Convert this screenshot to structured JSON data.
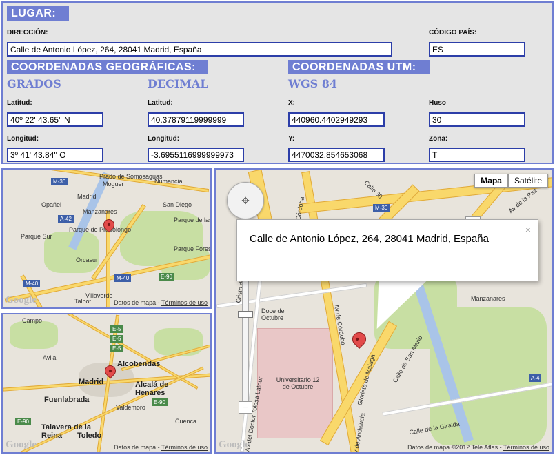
{
  "form": {
    "lugar_tag": "LUGAR:",
    "direccion_label": "DIRECCIÓN:",
    "direccion_value": "Calle de Antonio Lópe​z, 264, 28041 Madrid, España",
    "codigo_pais_label": "CÓDIGO PAÍS:",
    "codigo_pais_value": "ES",
    "geo_tag": "COORDENADAS GEOGRÁFICAS:",
    "utm_tag": "COORDENADAS UTM:",
    "grados_title": "GRADOS",
    "decimal_title": "DECIMAL",
    "wgs_title": "WGS 84",
    "latitud_label": "Latitud:",
    "longitud_label": "Longitud:",
    "x_label": "X:",
    "y_label": "Y:",
    "huso_label": "Huso",
    "zona_label": "Zona:",
    "lat_dms": "40º 22' 43.65'' N",
    "lon_dms": "3º 41' 43.84'' O",
    "lat_dec": "40.37879119999999",
    "lon_dec": "-3.6955116999999973",
    "utm_x": "440960.4402949293",
    "utm_y": "4470032.854653068",
    "huso": "30",
    "zona": "T"
  },
  "map_small_top": {
    "labels": [
      "Prado de Somosaguas",
      "Moguer",
      "Numancia",
      "Opañel",
      "San Diego",
      "Parque de las Palomeras",
      "Parque Sur",
      "Parque de Pradolongo",
      "Parque Forestal de Entrevías",
      "Orcasur",
      "Villaverde",
      "Talbot",
      "Manzanares",
      "Madrid"
    ],
    "shields": [
      "M-30",
      "A-42",
      "M-40",
      "E-90",
      "M-40"
    ],
    "footer_data": "Datos de mapa",
    "footer_terms": "Términos de uso",
    "logo": "Google"
  },
  "map_small_bottom": {
    "labels": [
      "Campo",
      "Avila",
      "Alcobendas",
      "Madrid",
      "Alcalá de Henares",
      "Fuenlabrada",
      "Valdemoro",
      "Talavera de la Reina",
      "Toledo",
      "Cuenca"
    ],
    "shields": [
      "E-5",
      "E-5",
      "E-5",
      "E-90",
      "E-90"
    ],
    "footer_data": "Datos de mapa",
    "footer_terms": "Términos de uso",
    "logo": "Google"
  },
  "map_big": {
    "map_type_map": "Mapa",
    "map_type_sat": "Satélite",
    "info_text": "Calle de Antonio López, 264, 28041 Madrid, España",
    "close": "×",
    "labels": [
      "Av de Córdoba",
      "Calle 30",
      "Av de la Paz",
      "Manzanares",
      "Doce de Octubre",
      "Universitario 12 de Octubre",
      "Glorieta de Málaga",
      "Calle de San Mario",
      "Calle de la Giralda",
      "Av de Córdoba",
      "Av del Doctor Tolosa Latour",
      "Cristo de la Victoria",
      "Av de Andalucía"
    ],
    "shields": [
      "M-30",
      "A-4",
      "12B"
    ],
    "zoom_in": "+",
    "zoom_out": "−",
    "footer_data": "Datos de mapa ©2012 Tele Atlas",
    "footer_terms": "Términos de uso",
    "logo": "Google"
  }
}
